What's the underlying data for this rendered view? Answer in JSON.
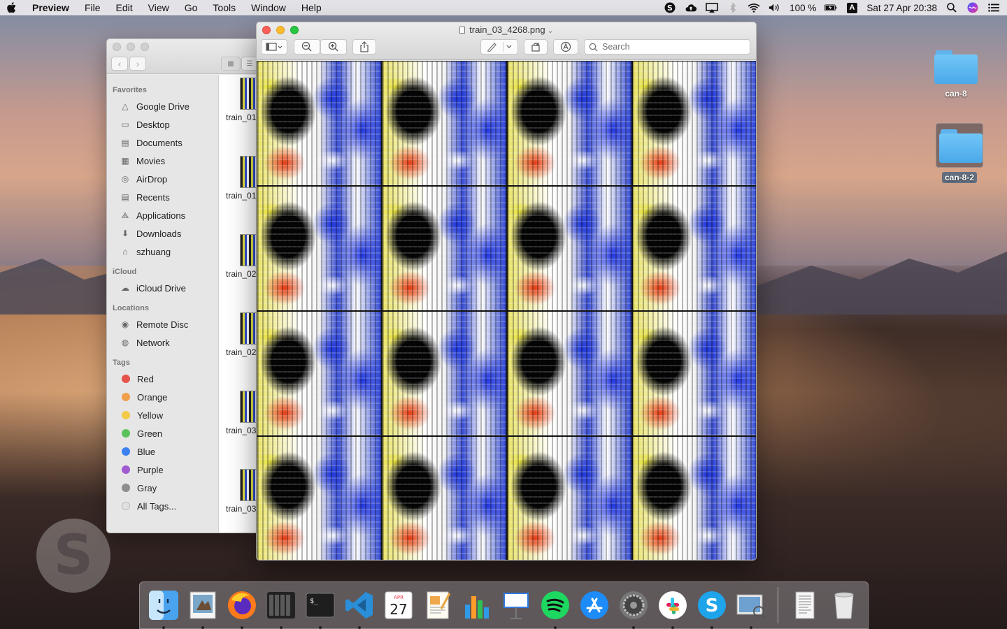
{
  "menubar": {
    "app_name": "Preview",
    "menus": [
      "File",
      "Edit",
      "View",
      "Go",
      "Tools",
      "Window",
      "Help"
    ],
    "battery": "100 %",
    "input_source": "A",
    "datetime": "Sat 27 Apr  20:38"
  },
  "desktop": {
    "icons": [
      {
        "label": "can-8"
      },
      {
        "label": "can-8-2"
      }
    ]
  },
  "finder": {
    "sections": {
      "favorites": "Favorites",
      "icloud": "iCloud",
      "locations": "Locations",
      "tags": "Tags"
    },
    "favorites": [
      "Google Drive",
      "Desktop",
      "Documents",
      "Movies",
      "AirDrop",
      "Recents",
      "Applications",
      "Downloads",
      "szhuang"
    ],
    "icloud": [
      "iCloud Drive"
    ],
    "locations": [
      "Remote Disc",
      "Network"
    ],
    "tags": [
      {
        "label": "Red",
        "color": "#e5534b"
      },
      {
        "label": "Orange",
        "color": "#f0a04b"
      },
      {
        "label": "Yellow",
        "color": "#f3c948"
      },
      {
        "label": "Green",
        "color": "#5bc25b"
      },
      {
        "label": "Blue",
        "color": "#3b82f0"
      },
      {
        "label": "Purple",
        "color": "#a05bd0"
      },
      {
        "label": "Gray",
        "color": "#8e8e8e"
      },
      {
        "label": "All Tags...",
        "color": "#e0e0e0"
      }
    ],
    "files": [
      "train_01",
      "train_01",
      "train_02",
      "train_02",
      "train_03",
      "train_03"
    ]
  },
  "preview": {
    "title": "train_03_4268.png",
    "search_placeholder": "Search"
  },
  "dock": {
    "items": [
      "Finder",
      "Preview",
      "Firefox",
      "Activity Monitor",
      "Terminal",
      "Visual Studio Code",
      "Calendar",
      "Pages",
      "Numbers",
      "Keynote",
      "Spotify",
      "App Store",
      "System Preferences",
      "Slack",
      "Skype",
      "Preview",
      "Documents",
      "Trash"
    ],
    "calendar_month": "APR",
    "calendar_day": "27"
  },
  "colors": {
    "close": "#fc5f57",
    "minimize": "#fdbc2e",
    "zoom": "#29c840",
    "selection": "#636f80"
  }
}
